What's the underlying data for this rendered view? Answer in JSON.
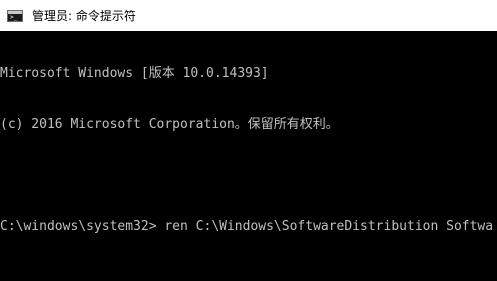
{
  "window": {
    "title": "管理员: 命令提示符",
    "icon": "cmd-icon"
  },
  "console": {
    "lines": [
      "Microsoft Windows [版本 10.0.14393]",
      "(c) 2016 Microsoft Corporation。保留所有权利。",
      "",
      "C:\\windows\\system32> ren C:\\Windows\\SoftwareDistribution Softwa"
    ],
    "text_color": "#c0c0c0",
    "background_color": "#000000"
  }
}
